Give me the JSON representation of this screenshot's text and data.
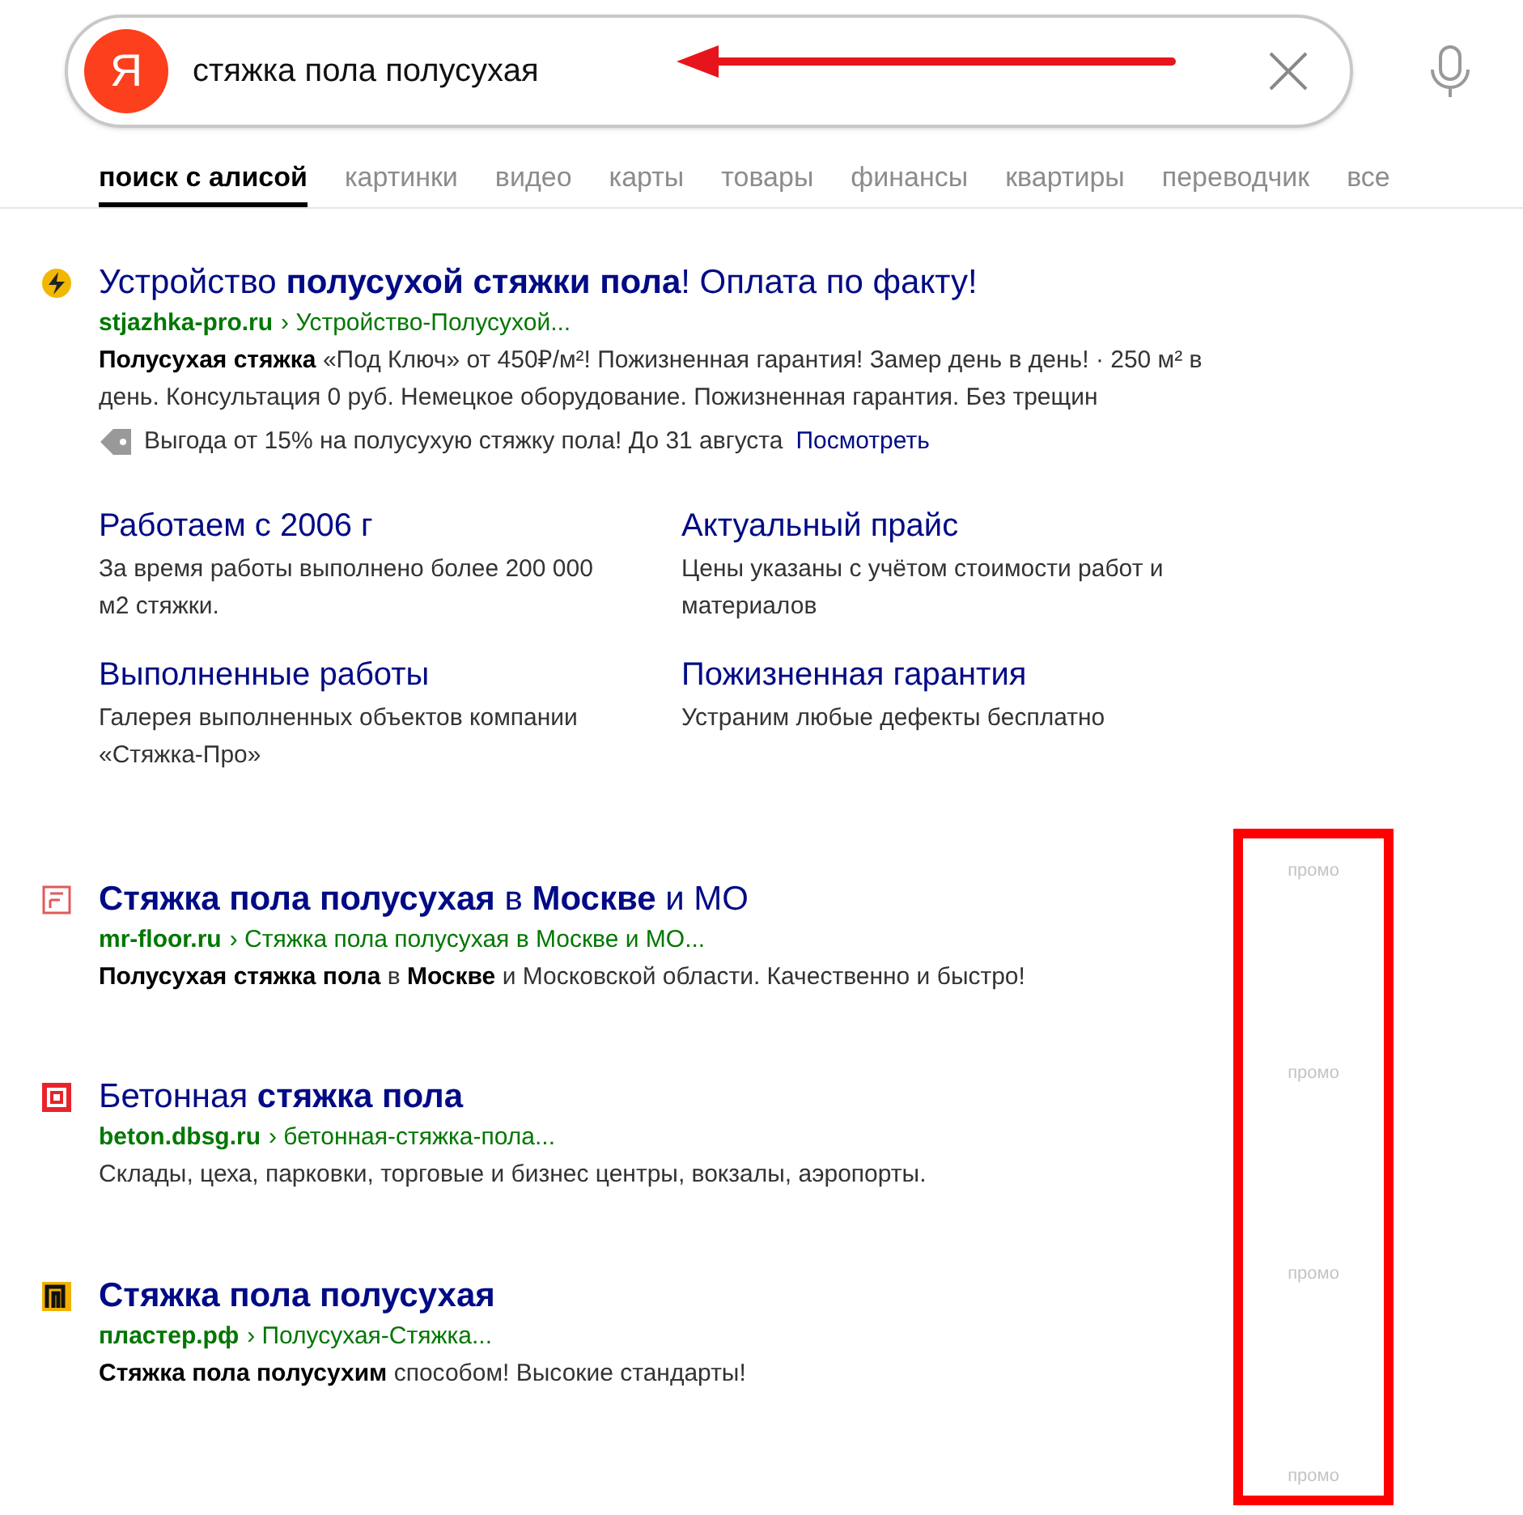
{
  "search": {
    "query": "стяжка пола полусухая",
    "logo": "Я"
  },
  "tabs": [
    {
      "label": "поиск с алисой",
      "selected": true
    },
    {
      "label": "картинки",
      "selected": false
    },
    {
      "label": "видео",
      "selected": false
    },
    {
      "label": "карты",
      "selected": false
    },
    {
      "label": "товары",
      "selected": false
    },
    {
      "label": "финансы",
      "selected": false
    },
    {
      "label": "квартиры",
      "selected": false
    },
    {
      "label": "переводчик",
      "selected": false
    },
    {
      "label": "все",
      "selected": false
    }
  ],
  "results": [
    {
      "title": "Устройство **полусухой стяжки пола**! Оплата по факту!",
      "domain": "stjazhka-pro.ru",
      "path": "› Устройство-Полусухой...",
      "snippet": "**Полусухая стяжка** «Под Ключ» от 450₽/м²! Пожизненная гарантия! Замер день в день! · 250 м² в день. Консультация 0 руб. Немецкое оборудование. Пожизненная гарантия. Без трещин",
      "offer": {
        "text": "Выгода от 15% на полусухую стяжку пола! До 31 августа",
        "link": "Посмотреть"
      },
      "sitelinks": [
        {
          "title": "Работаем с 2006 г",
          "text": "За время работы выполнено более 200 000 м2 стяжки."
        },
        {
          "title": "Актуальный прайс",
          "text": "Цены указаны с учётом стоимости работ и материалов"
        },
        {
          "title": "Выполненные работы",
          "text": "Галерея выполненных объектов компании «Стяжка-Про»"
        },
        {
          "title": "Пожизненная гарантия",
          "text": "Устраним любые дефекты бесплатно"
        }
      ]
    },
    {
      "title": "**Стяжка пола полусухая** в **Москве** и МО",
      "domain": "mr-floor.ru",
      "path": "› Стяжка пола полусухая в Москве и МО...",
      "snippet": "**Полусухая стяжка пола** в **Москве** и Московской области. Качественно и быстро!"
    },
    {
      "title": "Бетонная **стяжка пола**",
      "domain": "beton.dbsg.ru",
      "path": "› бетонная-стяжка-пола...",
      "snippet": "Склады, цеха, парковки, торговые и бизнес центры, вокзалы, аэропорты."
    },
    {
      "title": "**Стяжка пола полусухая**",
      "domain": "пластер.рф",
      "path": "› Полусухая-Стяжка...",
      "snippet": "**Стяжка пола полусухим** способом! Высокие стандарты!"
    }
  ],
  "promo_labels": [
    "промо",
    "промо",
    "промо",
    "промо"
  ]
}
